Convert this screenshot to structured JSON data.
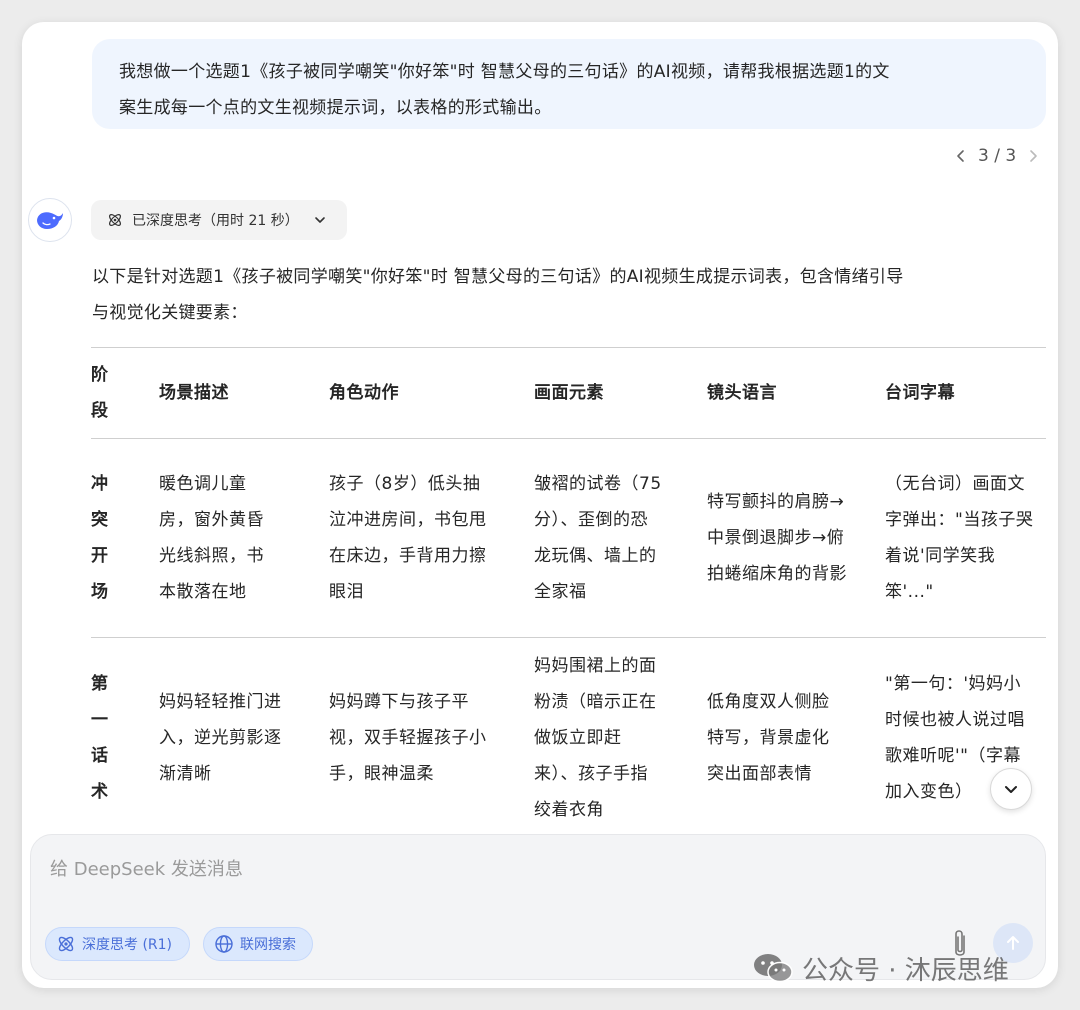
{
  "user_message": {
    "line1": "我想做一个选题1《孩子被同学嘲笑\"你好笨\"时 智慧父母的三句话》的AI视频，请帮我根据选题1的文",
    "line2": "案生成每一个点的文生视频提示词，以表格的形式输出。"
  },
  "pager": {
    "count": "3 / 3"
  },
  "think_pill": {
    "label": "已深度思考（用时 21 秒）"
  },
  "intro": {
    "line1": "以下是针对选题1《孩子被同学嘲笑\"你好笨\"时 智慧父母的三句话》的AI视频生成提示词表，包含情绪引导",
    "line2": "与视觉化关键要素："
  },
  "table": {
    "headers": [
      "阶段",
      "场景描述",
      "角色动作",
      "画面元素",
      "镜头语言",
      "台词字幕"
    ],
    "rows": [
      [
        "冲突开场",
        "暖色调儿童房，窗外黄昏光线斜照，书本散落在地",
        "孩子（8岁）低头抽泣冲进房间，书包甩在床边，手背用力擦眼泪",
        "皱褶的试卷（75分）、歪倒的恐龙玩偶、墙上的全家福",
        "特写颤抖的肩膀→中景倒退脚步→俯拍蜷缩床角的背影",
        "（无台词）画面文字弹出：\"当孩子哭着说'同学笑我笨'...\""
      ],
      [
        "第一话术",
        "妈妈轻轻推门进入，逆光剪影逐渐清晰",
        "妈妈蹲下与孩子平视，双手轻握孩子小手，眼神温柔",
        "妈妈围裙上的面粉渍（暗示正在做饭立即赶来）、孩子手指绞着衣角",
        "低角度双人侧脸特写，背景虚化突出面部表情",
        "\"第一句：'妈妈小时候也被人说过唱歌难听呢'\"（字幕加入变色）"
      ]
    ]
  },
  "input": {
    "placeholder": "给 DeepSeek 发送消息",
    "chip_deep": "深度思考 (R1)",
    "chip_web": "联网搜索"
  },
  "watermark": {
    "text": "公众号 · 沐辰思维"
  },
  "icons": [
    "chevron-left-icon",
    "chevron-right-icon",
    "deepseek-whale-icon",
    "atom-icon",
    "chevron-down-icon",
    "globe-icon",
    "paperclip-icon",
    "arrow-up-icon",
    "wechat-icon"
  ],
  "colors": {
    "accent": "#4d6bfe",
    "bubble": "#eff5fe",
    "chip_bg": "#dbe8fd"
  }
}
